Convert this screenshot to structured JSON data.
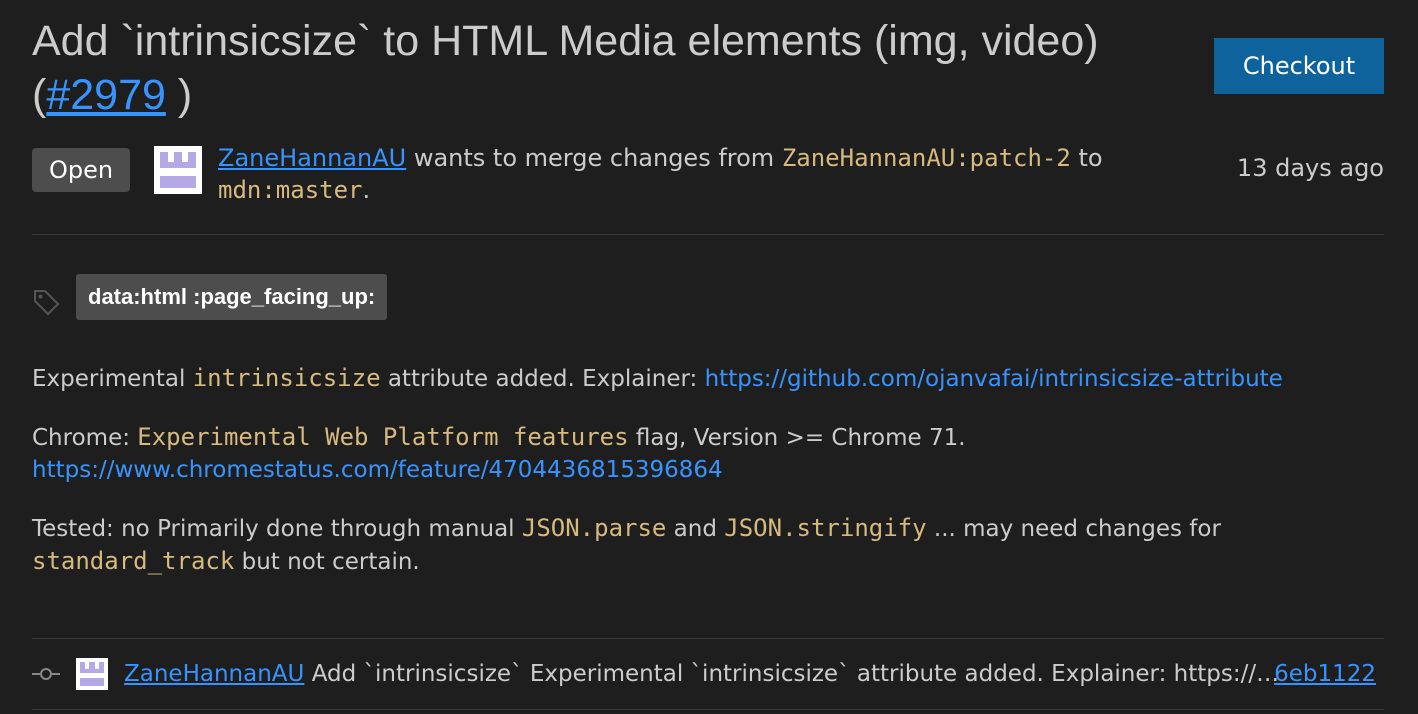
{
  "pr": {
    "title": "Add `intrinsicsize` to HTML Media elements (img, video)",
    "number_prefix": "(",
    "number": "#2979",
    "number_suffix": " )",
    "checkout_label": "Checkout"
  },
  "meta": {
    "status": "Open",
    "author": "ZaneHannanAU",
    "merge_text": "wants to merge changes from",
    "source_branch": "ZaneHannanAU:patch-2",
    "to_text": "to",
    "target_branch": "mdn:master",
    "period": ".",
    "time_ago": "13 days ago"
  },
  "labels": [
    {
      "name": "data:html :page_facing_up:"
    }
  ],
  "description": {
    "p1_pre": "Experimental ",
    "p1_code": "intrinsicsize",
    "p1_mid": " attribute added. Explainer: ",
    "p1_link": "https://github.com/ojanvafai/intrinsicsize-attribute",
    "p2_pre": "Chrome: ",
    "p2_code": "Experimental Web Platform features",
    "p2_mid": " flag, Version >= Chrome 71.",
    "p2_link": "https://www.chromestatus.com/feature/4704436815396864",
    "p3_pre": "Tested: no Primarily done through manual ",
    "p3_code1": "JSON.parse",
    "p3_and": " and ",
    "p3_code2": "JSON.stringify",
    "p3_mid": " ... may need changes for ",
    "p3_code3": "standard_track",
    "p3_end": " but not certain."
  },
  "commit": {
    "author": "ZaneHannanAU",
    "message": "Add `intrinsicsize` Experimental `intrinsicsize` attribute added. Explainer: https://github.com/ojanvafai/intrinsicsize-attribute",
    "sha": "6eb1122"
  },
  "icons": {
    "tag": "tag-icon",
    "commit": "git-commit-icon",
    "avatar": "identicon-avatar"
  },
  "colors": {
    "background": "#1e1e1e",
    "text": "#cccccc",
    "link": "#3794ff",
    "code": "#d7ba7d",
    "button": "#0e639c",
    "badge": "#4d4d4d"
  }
}
